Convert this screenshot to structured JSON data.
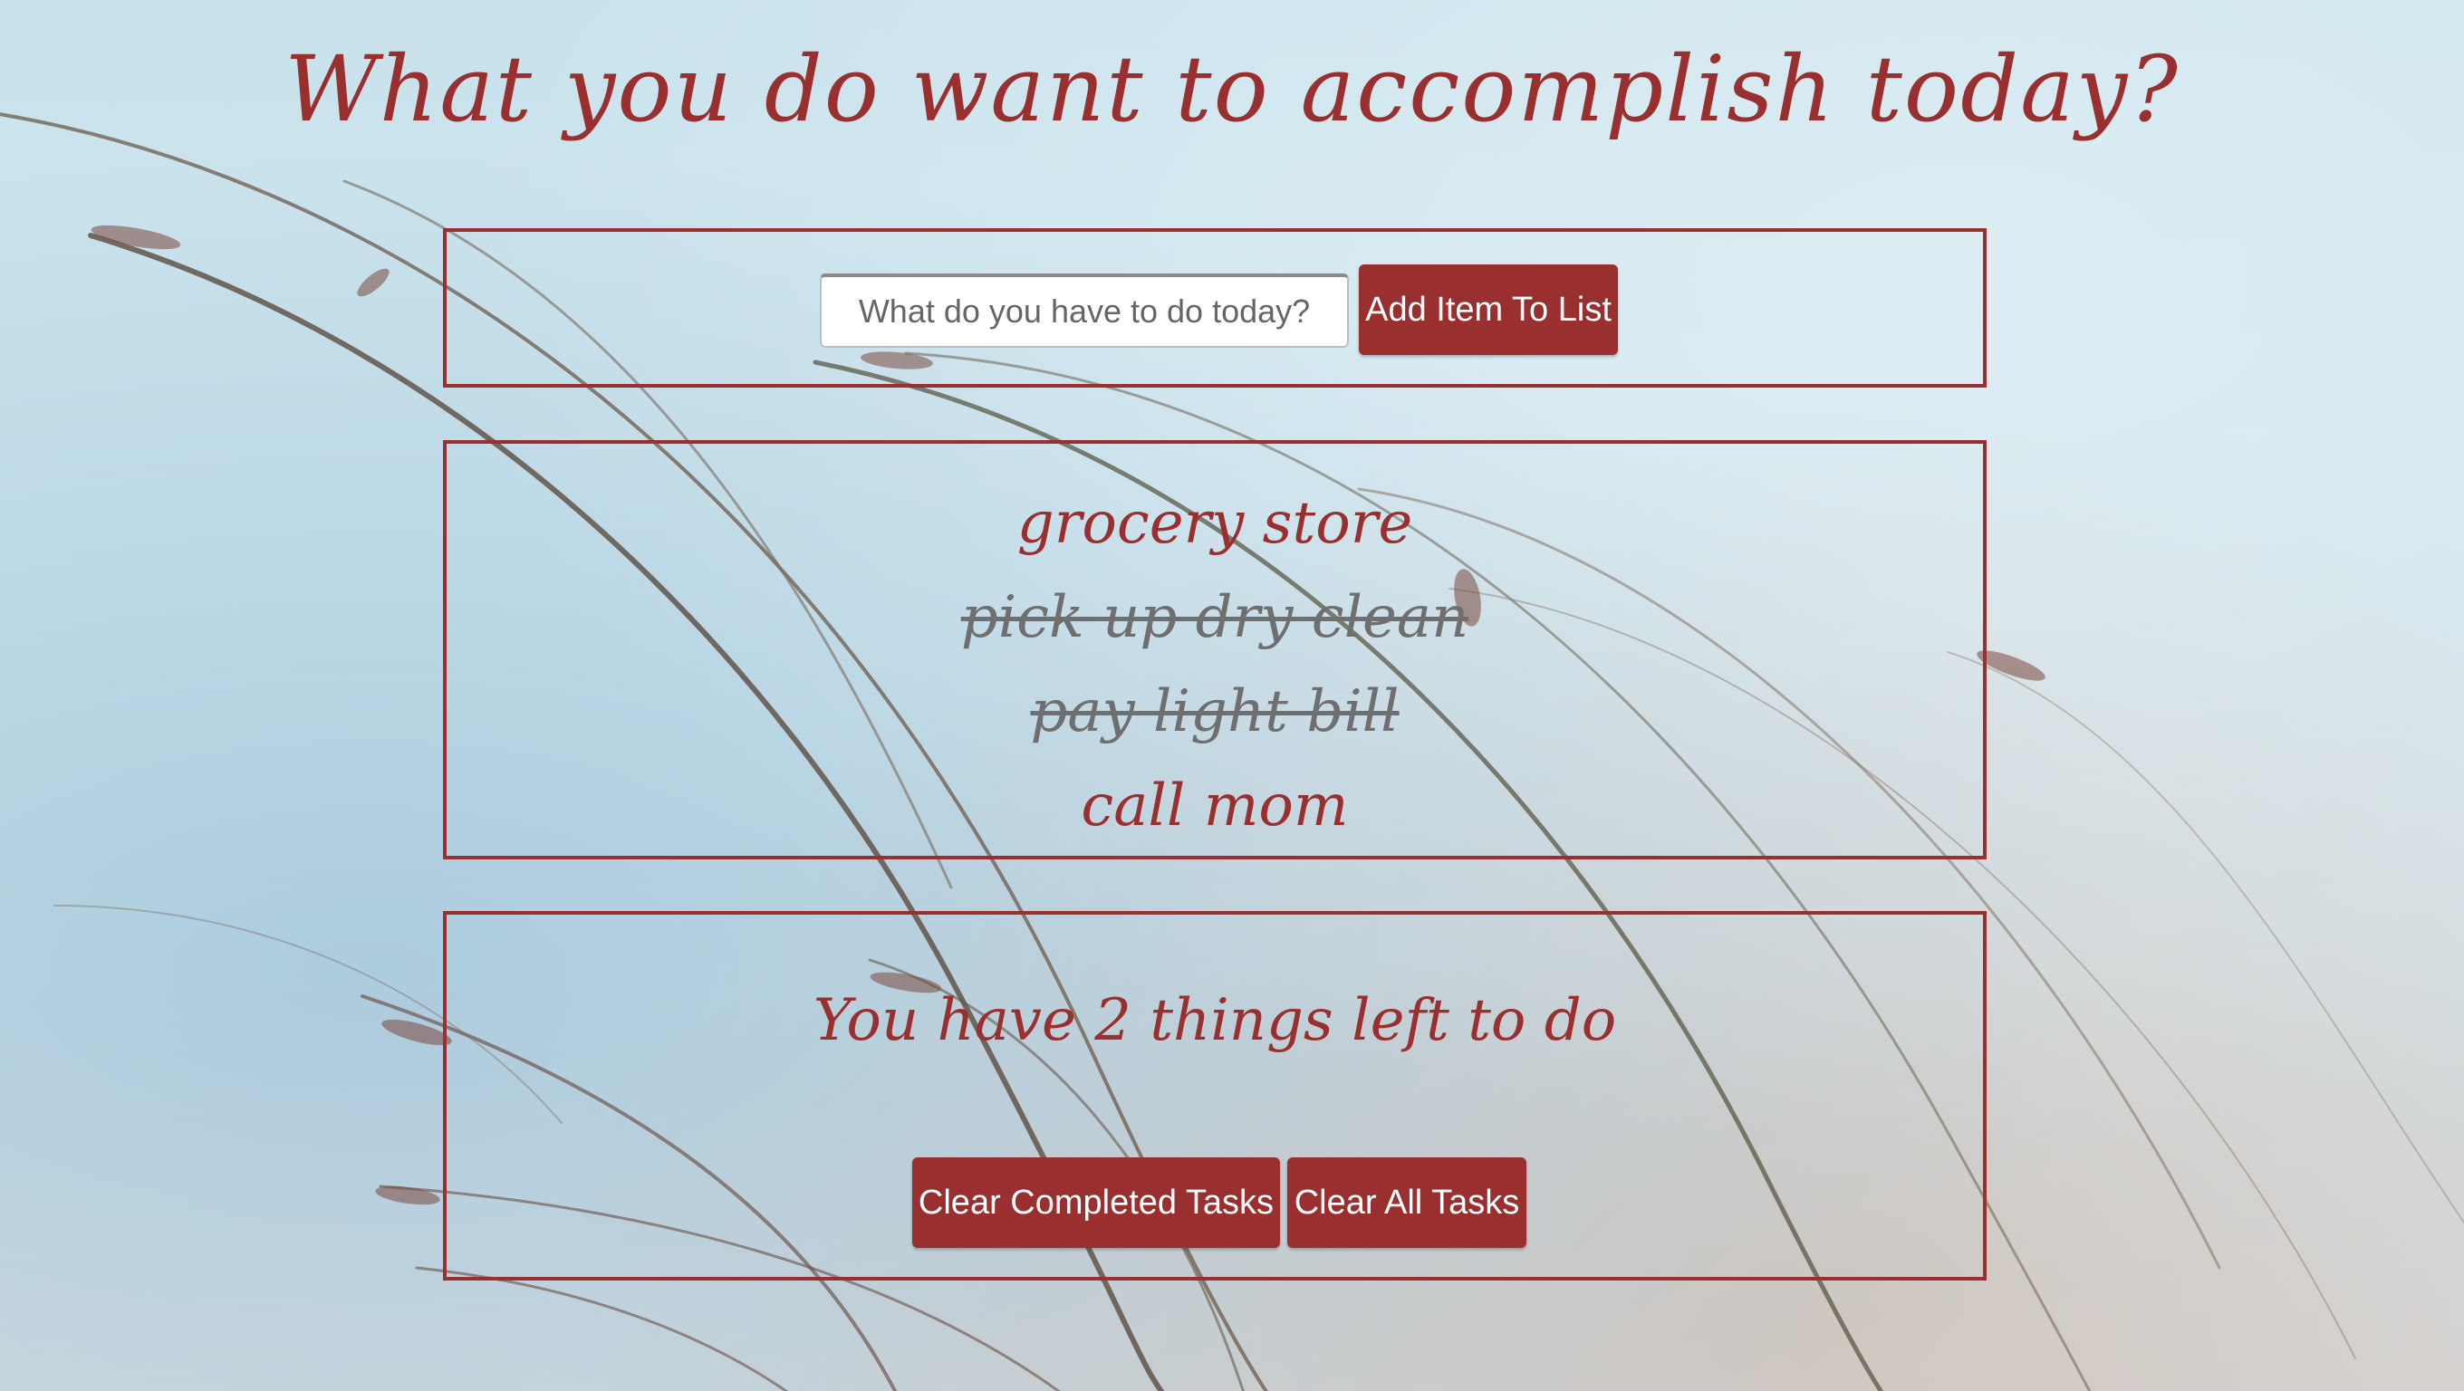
{
  "header": {
    "title": "What you do want to accomplish today?"
  },
  "input_panel": {
    "placeholder": "What do you have to do today?",
    "value": "",
    "add_button_label": "Add Item To List"
  },
  "task_list": {
    "items": [
      {
        "label": "grocery store",
        "completed": false
      },
      {
        "label": "pick up dry clean",
        "completed": true
      },
      {
        "label": "pay light bill",
        "completed": true
      },
      {
        "label": "call mom",
        "completed": false
      }
    ]
  },
  "footer": {
    "remaining_text": "You have 2 things left to do",
    "clear_completed_label": "Clear Completed Tasks",
    "clear_all_label": "Clear All Tasks"
  },
  "colors": {
    "accent": "#9a2f2f",
    "completed_text": "#6f6f6f",
    "background": "#cfe5ee"
  }
}
